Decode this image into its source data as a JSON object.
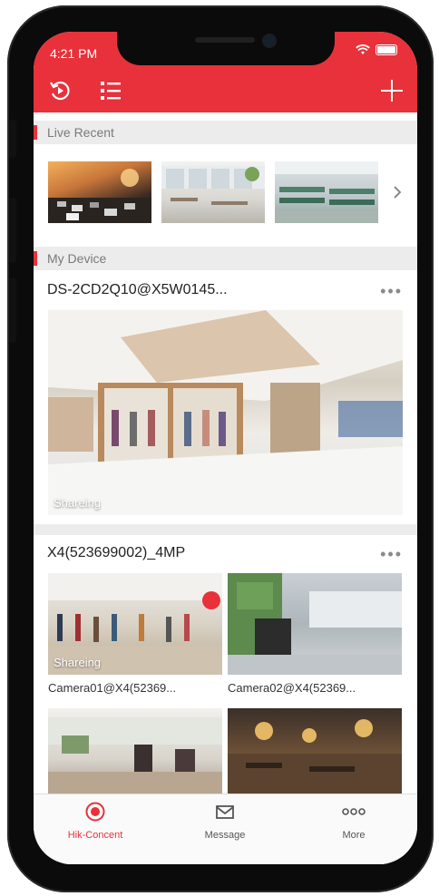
{
  "status": {
    "time": "4:21 PM"
  },
  "header": {
    "left_icons": [
      "replay-icon",
      "list-icon"
    ],
    "right_icon": "plus-icon",
    "accent": "#e8313a"
  },
  "live_recent": {
    "title": "Live Recent",
    "thumbnails": [
      "traffic-scene",
      "cafe-scene",
      "office-scene"
    ]
  },
  "my_device": {
    "title": "My Device",
    "devices": [
      {
        "name": "DS-2CD2Q10@X5W0145...",
        "preview_tag": "Shareing"
      },
      {
        "name": "X4(523699002)_4MP",
        "cameras": [
          {
            "label": "Camera01@X4(52369...",
            "tag": "Shareing"
          },
          {
            "label": "Camera02@X4(52369...",
            "tag": ""
          }
        ]
      }
    ]
  },
  "tabs": [
    {
      "label": "Hik-Concent",
      "icon": "record-icon",
      "active": true
    },
    {
      "label": "Message",
      "icon": "mail-icon",
      "active": false
    },
    {
      "label": "More",
      "icon": "dots-icon",
      "active": false
    }
  ],
  "colors": {
    "active": "#e8313a",
    "inactive": "#555555"
  }
}
